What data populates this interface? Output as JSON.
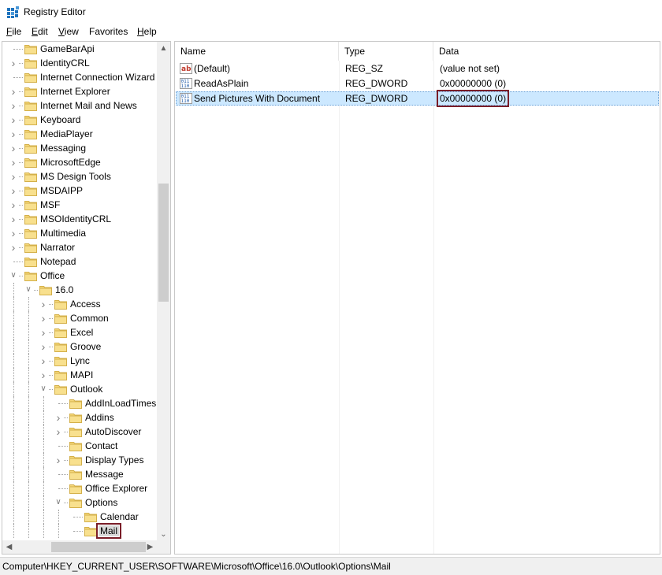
{
  "window": {
    "title": "Registry Editor"
  },
  "menu": {
    "items": [
      {
        "label": "File",
        "u": "F",
        "rest": "ile"
      },
      {
        "label": "Edit",
        "u": "E",
        "rest": "dit"
      },
      {
        "label": "View",
        "u": "V",
        "rest": "iew"
      },
      {
        "label": "Favorites",
        "u": "",
        "rest": "Favorites"
      },
      {
        "label": "Help",
        "u": "H",
        "rest": "elp"
      }
    ]
  },
  "tree": {
    "items": [
      {
        "label": "GameBarApi",
        "level": 1,
        "expander": "none"
      },
      {
        "label": "IdentityCRL",
        "level": 1,
        "expander": "collapsed"
      },
      {
        "label": "Internet Connection Wizard",
        "level": 1,
        "expander": "none"
      },
      {
        "label": "Internet Explorer",
        "level": 1,
        "expander": "collapsed"
      },
      {
        "label": "Internet Mail and News",
        "level": 1,
        "expander": "collapsed"
      },
      {
        "label": "Keyboard",
        "level": 1,
        "expander": "collapsed"
      },
      {
        "label": "MediaPlayer",
        "level": 1,
        "expander": "collapsed"
      },
      {
        "label": "Messaging",
        "level": 1,
        "expander": "collapsed"
      },
      {
        "label": "MicrosoftEdge",
        "level": 1,
        "expander": "collapsed"
      },
      {
        "label": "MS Design Tools",
        "level": 1,
        "expander": "collapsed"
      },
      {
        "label": "MSDAIPP",
        "level": 1,
        "expander": "collapsed"
      },
      {
        "label": "MSF",
        "level": 1,
        "expander": "collapsed"
      },
      {
        "label": "MSOIdentityCRL",
        "level": 1,
        "expander": "collapsed"
      },
      {
        "label": "Multimedia",
        "level": 1,
        "expander": "collapsed"
      },
      {
        "label": "Narrator",
        "level": 1,
        "expander": "collapsed"
      },
      {
        "label": "Notepad",
        "level": 1,
        "expander": "none"
      },
      {
        "label": "Office",
        "level": 1,
        "expander": "expanded"
      },
      {
        "label": "16.0",
        "level": 2,
        "expander": "expanded"
      },
      {
        "label": "Access",
        "level": 3,
        "expander": "collapsed"
      },
      {
        "label": "Common",
        "level": 3,
        "expander": "collapsed"
      },
      {
        "label": "Excel",
        "level": 3,
        "expander": "collapsed"
      },
      {
        "label": "Groove",
        "level": 3,
        "expander": "collapsed"
      },
      {
        "label": "Lync",
        "level": 3,
        "expander": "collapsed"
      },
      {
        "label": "MAPI",
        "level": 3,
        "expander": "collapsed"
      },
      {
        "label": "Outlook",
        "level": 3,
        "expander": "expanded"
      },
      {
        "label": "AddInLoadTimes",
        "level": 4,
        "expander": "none"
      },
      {
        "label": "Addins",
        "level": 4,
        "expander": "collapsed"
      },
      {
        "label": "AutoDiscover",
        "level": 4,
        "expander": "collapsed"
      },
      {
        "label": "Contact",
        "level": 4,
        "expander": "none"
      },
      {
        "label": "Display Types",
        "level": 4,
        "expander": "collapsed"
      },
      {
        "label": "Message",
        "level": 4,
        "expander": "none"
      },
      {
        "label": "Office Explorer",
        "level": 4,
        "expander": "none"
      },
      {
        "label": "Options",
        "level": 4,
        "expander": "expanded"
      },
      {
        "label": "Calendar",
        "level": 5,
        "expander": "none"
      },
      {
        "label": "Mail",
        "level": 5,
        "expander": "none",
        "selected": true
      }
    ]
  },
  "list": {
    "headers": {
      "name": "Name",
      "type": "Type",
      "data": "Data"
    },
    "rows": [
      {
        "name": "(Default)",
        "type": "REG_SZ",
        "data": "(value not set)",
        "icon": "string-value-icon"
      },
      {
        "name": "ReadAsPlain",
        "type": "REG_DWORD",
        "data": "0x00000000 (0)",
        "icon": "binary-value-icon"
      },
      {
        "name": "Send Pictures With Document",
        "type": "REG_DWORD",
        "data": "0x00000000 (0)",
        "icon": "binary-value-icon",
        "selected": true
      }
    ]
  },
  "status": {
    "path": "Computer\\HKEY_CURRENT_USER\\SOFTWARE\\Microsoft\\Office\\16.0\\Outlook\\Options\\Mail"
  },
  "colors": {
    "accent_outline": "#7a1d28",
    "selection": "#cce8ff",
    "folder": "#f5d77a"
  }
}
